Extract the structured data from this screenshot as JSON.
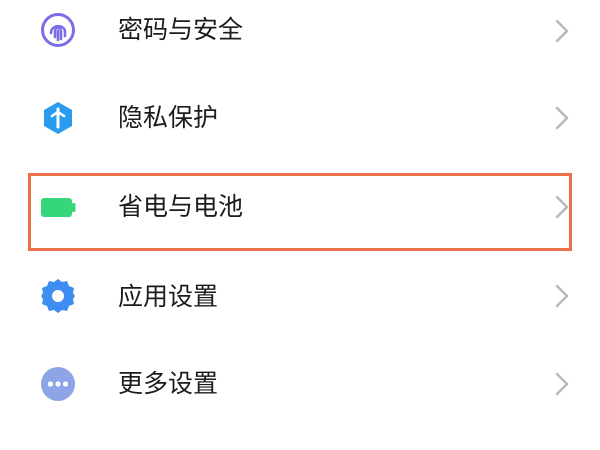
{
  "settings": {
    "items": [
      {
        "label": "密码与安全",
        "icon": "fingerprint-icon",
        "icon_color": "#7b6ee6"
      },
      {
        "label": "隐私保护",
        "icon": "privacy-shield-icon",
        "icon_color": "#2b9bf0"
      },
      {
        "label": "省电与电池",
        "icon": "battery-icon",
        "icon_color": "#36d67a"
      },
      {
        "label": "应用设置",
        "icon": "gear-icon",
        "icon_color": "#3d8ef0"
      },
      {
        "label": "更多设置",
        "icon": "more-dots-icon",
        "icon_color": "#8fa4e8"
      }
    ],
    "highlighted_item": "省电与电池",
    "highlight_color": "#ee7048"
  }
}
